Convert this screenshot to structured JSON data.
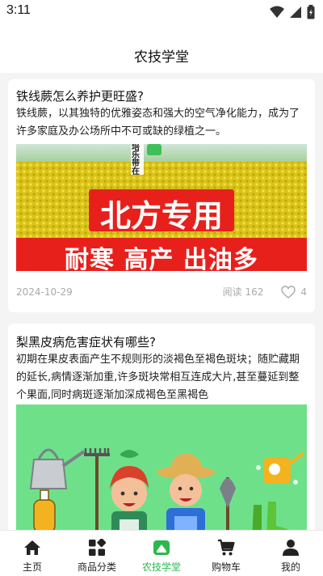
{
  "status": {
    "time": "3:11"
  },
  "header": {
    "title": "农技学堂"
  },
  "articles": [
    {
      "title": "铁线蕨怎么养护更旺盛?",
      "desc": "铁线蕨，以其独特的优雅姿态和强大的空气净化能力，成为了许多家庭及办公场所中不可或缺的绿植之一。",
      "banner": {
        "top_text": "培乐带在",
        "main_text": "北方专用",
        "bottom_text": "耐寒 高产 出油多"
      },
      "date": "2024-10-29",
      "views": "阅读 162",
      "likes": "4"
    },
    {
      "title": "梨黑皮病危害症状有哪些?",
      "desc": "初期在果皮表面产生不规则形的淡褐色至褐色斑块；随贮藏期的延长,病情逐渐加重,许多斑块常相互连成大片,甚至蔓延到整个果面,同时病斑逐渐加深成褐色至黑褐色"
    }
  ],
  "tabs": [
    {
      "label": "主页",
      "icon": "home-icon"
    },
    {
      "label": "商品分类",
      "icon": "category-icon"
    },
    {
      "label": "农技学堂",
      "icon": "school-icon",
      "active": true
    },
    {
      "label": "购物车",
      "icon": "cart-icon"
    },
    {
      "label": "我的",
      "icon": "profile-icon"
    }
  ],
  "colors": {
    "accent": "#2db84d",
    "banner_red": "#e8201c",
    "banner_green": "#6ee08a"
  }
}
